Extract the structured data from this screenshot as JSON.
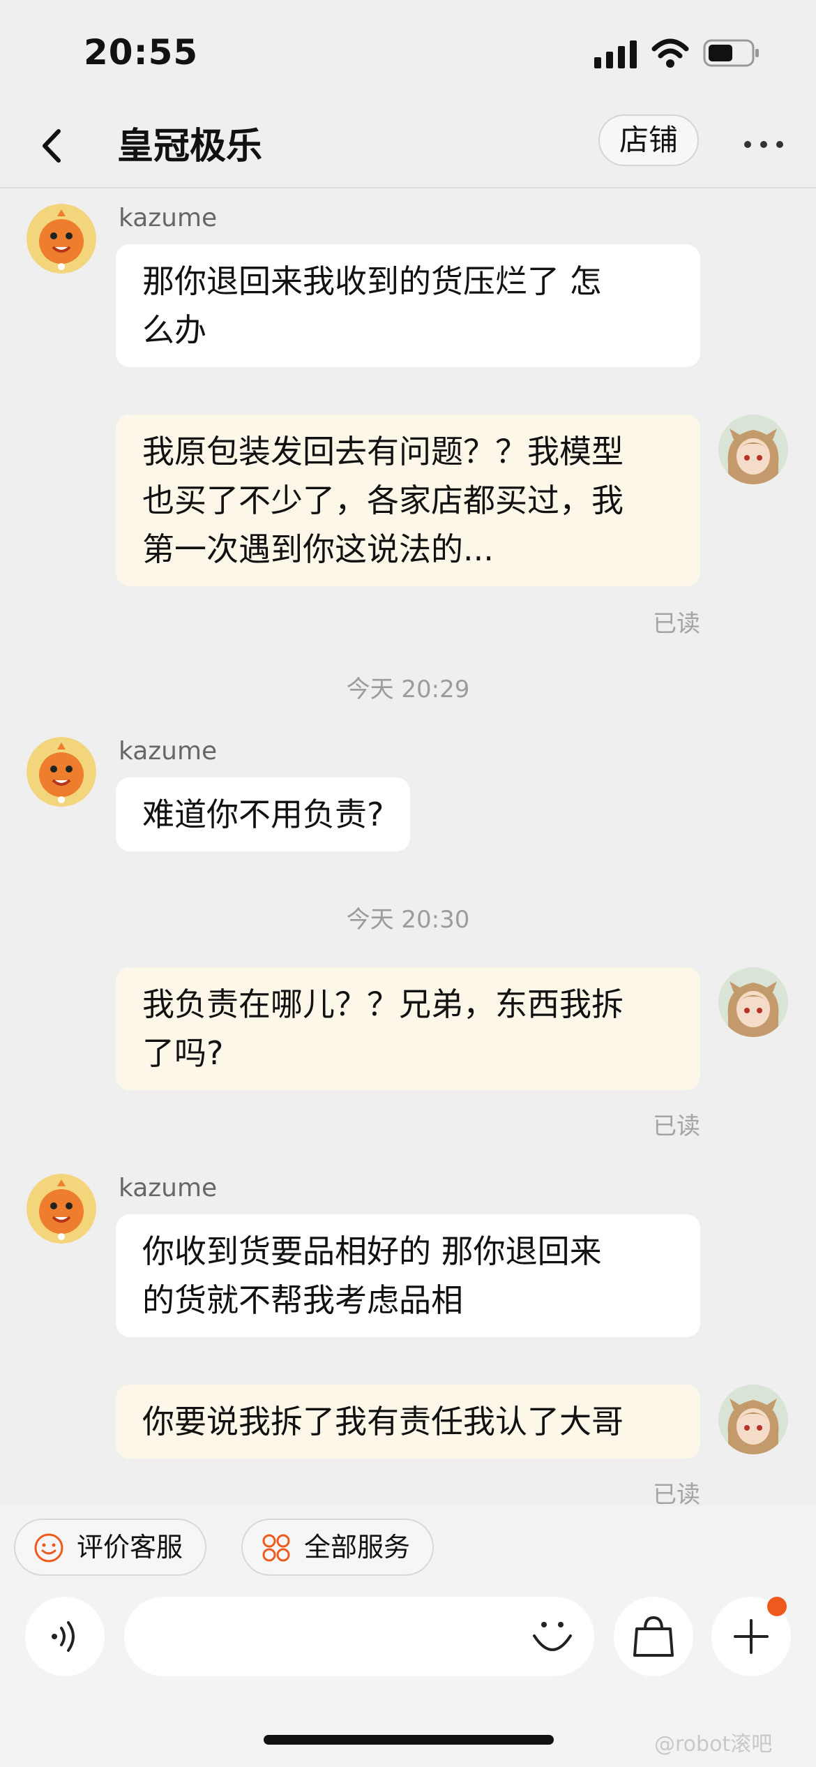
{
  "status_bar": {
    "time": "20:55"
  },
  "nav": {
    "title": "皇冠极乐",
    "shop_label": "店铺"
  },
  "messages": [
    {
      "sender": "kazume",
      "line1": "那你退回来我收到的货压烂了 怎",
      "line2": "么办"
    },
    {
      "line1": "我原包装发回去有问题？？我模型",
      "line2": "也买了不少了，各家店都买过，我",
      "line3": "第一次遇到你这说法的...",
      "read": "已读"
    },
    {
      "time": "今天 20:29"
    },
    {
      "sender": "kazume",
      "line1": "难道你不用负责?"
    },
    {
      "time": "今天 20:30"
    },
    {
      "line1": "我负责在哪儿？？兄弟，东西我拆",
      "line2": "了吗?",
      "read": "已读"
    },
    {
      "sender": "kazume",
      "line1": "你收到货要品相好的 那你退回来",
      "line2": "的货就不帮我考虑品相"
    },
    {
      "line1": "你要说我拆了我有责任我认了大哥",
      "read": "已读"
    }
  ],
  "bottom": {
    "rate_label": "评价客服",
    "services_label": "全部服务",
    "input_placeholder": ""
  },
  "watermark": "@robot滚吧",
  "colors": {
    "accent": "#ee5a1e",
    "outgoing_bubble": "#fcf7e8",
    "incoming_bubble": "#ffffff"
  }
}
